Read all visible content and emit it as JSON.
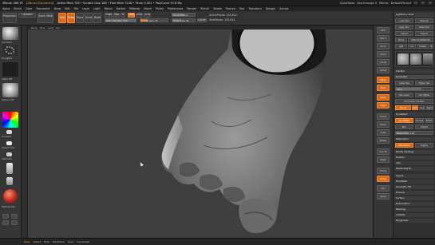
{
  "titlebar": {
    "app": "ZBrush 4R6 P2",
    "doc": "[ZBrush Document]",
    "info": "Active Mem 749 • Scratch Disk 185 • Free Mem 3148 • Timer 0.001 • PolyCount 97.8 Mp",
    "quicksave": "QuickSave",
    "see_through": "See-through 0",
    "menus": "Menus",
    "default": "DefaultZScript"
  },
  "menus": [
    "Alpha",
    "Brush",
    "Color",
    "Document",
    "Draw",
    "Edit",
    "File",
    "Layer",
    "Light",
    "Macro",
    "Marker",
    "Material",
    "Movie",
    "Picker",
    "Preferences",
    "Render",
    "Stencil",
    "Stroke",
    "Texture",
    "Tool",
    "Transform",
    "Zplugin",
    "Zscript"
  ],
  "shelf": {
    "projection": "Projection Master",
    "lightbox": "LightBox",
    "quicksketch": "Quick Sketch",
    "edit": "Edit",
    "draw": "Draw",
    "move": "Move",
    "scale": "Scale",
    "rotate": "Rotate",
    "mrgb": "Mrgb",
    "rgb": "Rgb",
    "m": "M",
    "zadd": "Zadd",
    "zsub": "Zsub",
    "zcut": "Zcut",
    "rgb_intensity": "Rgb Intensity 100",
    "z_intensity": "Z Intensity 25",
    "focal_shift": "Focal Shift 0",
    "draw_size": "Draw Size 64",
    "dynamic": "Dynamic",
    "active_points": "ActivePoints: 133,814",
    "total_points": "TotalPoints: 133,814"
  },
  "lefttray": {
    "brush_label": "Standard",
    "stroke_label": "DragRect",
    "alpha_label": "Alpha Off",
    "texture_label": "Texture Off",
    "material_label": "MatCap Red",
    "gradient": "Gradient",
    "switch": "SwitchColor",
    "alternate": "Alternate"
  },
  "rightstrip": [
    "BPR",
    "SPix 3",
    "Scroll",
    "Zoom",
    "Actual",
    "AAHalf",
    "Persp",
    "Floor",
    "Local",
    "L.Sym",
    "Frame",
    "Move",
    "Scale",
    "Rotate",
    "Line Fill",
    "PolyF",
    "Transp",
    "Ghost",
    "Solo",
    "Xpose"
  ],
  "rightpanel": {
    "lightbox": "Lightbox ▸ Tools",
    "load_tool": "Load Tool",
    "save_as": "Save As",
    "copy_tool": "Copy Tool",
    "paste_tool": "Paste Tool",
    "import": "Import",
    "export": "Export",
    "clone": "Clone",
    "make_polymesh": "Make PolyMesh3D",
    "goz": "GoZ",
    "all": "All",
    "visible": "Visible",
    "r": "R",
    "subtool": "SubTool",
    "geometry": "Geometry",
    "lower_res": "Lower Res",
    "higher_res": "Higher Res",
    "sdiv": "SDiv",
    "del_lower": "Del Lower",
    "del_higher": "Del Higher",
    "reconstruct": "Reconstruct Subdiv",
    "divide": "Divide",
    "smt": "Smt",
    "suv": "Suv",
    "reuv": "ReUV",
    "dynamesh": "DynaMesh",
    "groups": "Groups",
    "polish": "Polish",
    "blur": "Blur",
    "project": "Project",
    "resolution": "Resolution 128",
    "zremesher": "ZRemesher",
    "legacy": "Legacy",
    "modify_topology": "Modify Topology",
    "position": "Position",
    "size": "Size",
    "meshintegrity": "MeshIntegrity",
    "layers": "Layers",
    "fibermesh": "FiberMesh",
    "geometry_hd": "Geometry HD",
    "preview": "Preview",
    "surface": "Surface",
    "deformation": "Deformation",
    "masking": "Masking",
    "visibility": "Visibility",
    "polygroups": "Polygroups"
  },
  "canvas_tabs": [
    "Persp",
    "Floor",
    "Local",
    "Xyz"
  ],
  "bottombar": [
    "Mask",
    "Select",
    "Hide",
    "Polyframe",
    "Save",
    "Dynamesh"
  ]
}
